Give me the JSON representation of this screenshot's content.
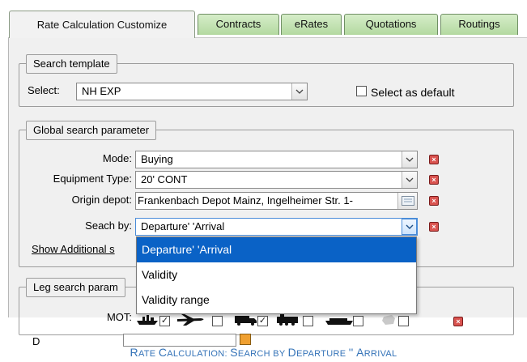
{
  "tabs": [
    {
      "label": "Rate Calculation Customize",
      "active": true
    },
    {
      "label": "Contracts"
    },
    {
      "label": "eRates"
    },
    {
      "label": "Quotations"
    },
    {
      "label": "Routings"
    }
  ],
  "search_template": {
    "legend": "Search template",
    "select_label": "Select:",
    "select_value": "NH EXP",
    "default_checkbox_label": "Select as default"
  },
  "global_search": {
    "legend": "Global search parameter",
    "mode_label": "Mode:",
    "mode_value": "Buying",
    "equipment_label": "Equipment Type:",
    "equipment_value": "20' CONT",
    "origin_label": "Origin depot:",
    "origin_value": "Frankenbach Depot Mainz, Ingelheimer Str. 1-",
    "search_by_label": "Seach by:",
    "search_by_value": "Departure' 'Arrival",
    "show_additional_link": "Show Additional s"
  },
  "dropdown": {
    "options": [
      "Departure' 'Arrival",
      "Validity",
      "Validity range"
    ],
    "selected_index": 0
  },
  "leg_search": {
    "legend": "Leg search param",
    "mot_label": "MOT:",
    "departure_label": "D"
  },
  "caption": {
    "r": "R",
    "ate": "ATE ",
    "c": "C",
    "alculation": "ALCULATION: ",
    "s": "S",
    "earch": "EARCH BY ",
    "d": "D",
    "eparture": "EPARTURE ",
    "quotes": "'' ",
    "a": "A",
    "rrival": "RRIVAL"
  },
  "colors": {
    "tab_green": "#b3d9a0",
    "selection_blue": "#0a62c6",
    "caption_blue": "#3473b8",
    "remove_red": "#d9534f"
  }
}
